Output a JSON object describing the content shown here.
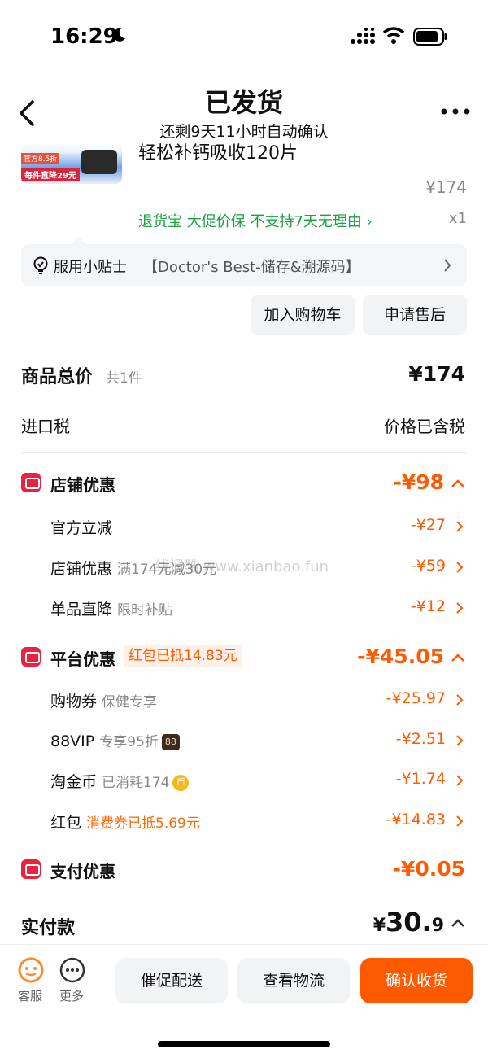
{
  "status": {
    "time": "16:29"
  },
  "header": {
    "title": "已发货",
    "subtitle": "还剩9天11小时自动确认"
  },
  "product": {
    "image_tag_top": "官方8.5折",
    "image_tag_bottom": "每件直降29元",
    "name": "轻松补钙吸收120片",
    "price": "¥174",
    "services": "退货宝  大促价保  不支持7天无理由 ›",
    "quantity": "x1"
  },
  "tips": {
    "title": "服用小贴士",
    "text": "【Doctor's Best-储存&溯源码】"
  },
  "actions": {
    "add_cart": "加入购物车",
    "after_sale": "申请售后"
  },
  "summary": {
    "total_label": "商品总价",
    "total_count": "共1件",
    "total_value": "¥174",
    "tax_label": "进口税",
    "tax_value": "价格已含税"
  },
  "store_discount": {
    "label": "店铺优惠",
    "amount": "-¥98",
    "items": [
      {
        "label": "官方立减",
        "sub": "",
        "amount": "-¥27"
      },
      {
        "label": "店铺优惠",
        "sub": "满174元减30元",
        "amount": "-¥59"
      },
      {
        "label": "单品直降",
        "sub": "限时补贴",
        "amount": "-¥12"
      }
    ]
  },
  "platform_discount": {
    "label": "平台优惠",
    "tag": "红包已抵14.83元",
    "amount": "-¥45.05",
    "items": [
      {
        "label": "购物券",
        "sub": "保健专享",
        "amount": "-¥25.97"
      },
      {
        "label": "88VIP",
        "sub": "专享95折",
        "badge": "88",
        "amount": "-¥2.51"
      },
      {
        "label": "淘金币",
        "sub": "已消耗174",
        "badge": "币",
        "amount": "-¥1.74"
      },
      {
        "label": "红包",
        "sub": "消费券已抵5.69元",
        "amount": "-¥14.83"
      }
    ]
  },
  "payment_discount": {
    "label": "支付优惠",
    "amount": "-¥0.05"
  },
  "paid": {
    "label": "实付款",
    "symbol": "¥",
    "integer": "30.",
    "decimal": "9"
  },
  "watermark": "线报酷 www.xianbao.fun",
  "bottom": {
    "service_label": "客服",
    "more_label": "更多",
    "urge_label": "催促配送",
    "logistics_label": "查看物流",
    "confirm_label": "确认收货"
  },
  "colors": {
    "accent": "#ff5a00",
    "green": "#1ba044",
    "red_icon": "#e8223f"
  }
}
